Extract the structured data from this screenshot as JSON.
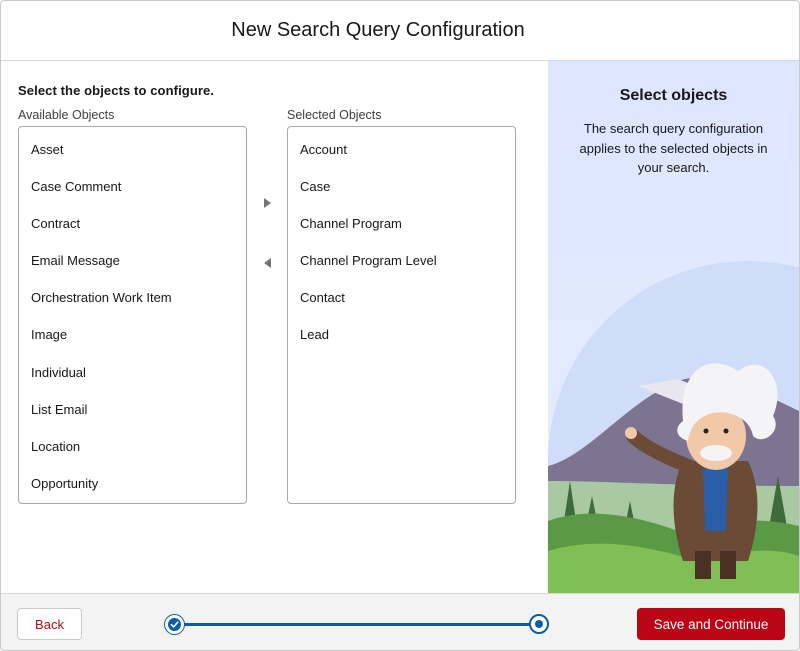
{
  "header": {
    "title": "New Search Query Configuration"
  },
  "main": {
    "instruction": "Select the objects to configure.",
    "available": {
      "label": "Available Objects",
      "items": [
        "Asset",
        "Case Comment",
        "Contract",
        "Email Message",
        "Orchestration Work Item",
        "Image",
        "Individual",
        "List Email",
        "Location",
        "Opportunity"
      ]
    },
    "selected": {
      "label": "Selected Objects",
      "items": [
        "Account",
        "Case",
        "Channel Program",
        "Channel Program Level",
        "Contact",
        "Lead"
      ]
    },
    "move_right_icon": "triangle-right-icon",
    "move_left_icon": "triangle-left-icon"
  },
  "side_panel": {
    "title": "Select objects",
    "description": "The search query configuration applies to the selected objects in your search."
  },
  "footer": {
    "back_label": "Back",
    "save_label": "Save and Continue",
    "progress": {
      "steps": 2,
      "current_step": 2
    }
  },
  "colors": {
    "brand_blue": "#0b5cab",
    "destructive_red": "#ba0517",
    "panel_bg": "#e2eaff"
  }
}
